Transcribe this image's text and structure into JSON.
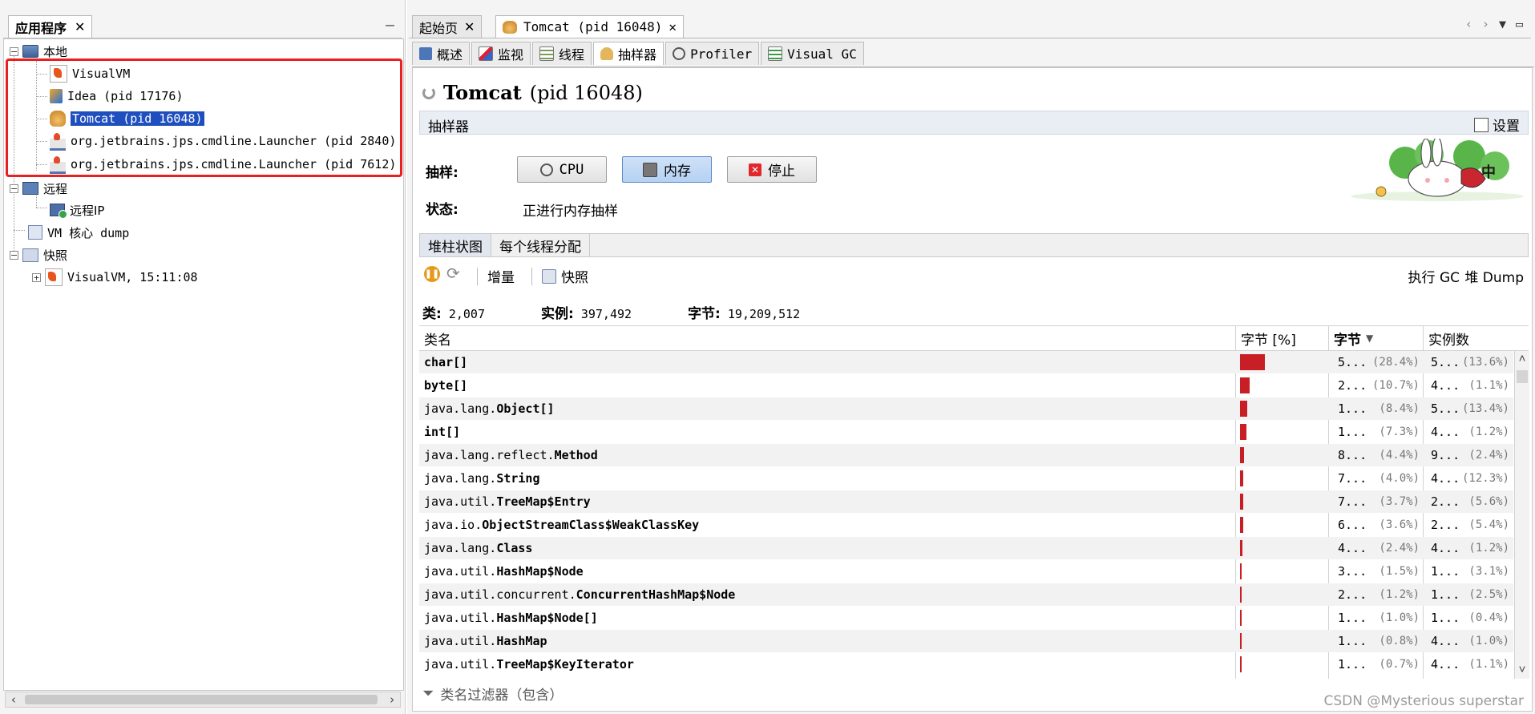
{
  "left_panel": {
    "tab_label": "应用程序",
    "minimize": "—",
    "tree": {
      "local": "本地",
      "visualvm": "VisualVM",
      "idea": "Idea (pid 17176)",
      "tomcat": "Tomcat (pid 16048)",
      "launcher1": "org.jetbrains.jps.cmdline.Launcher (pid 2840)",
      "launcher2": "org.jetbrains.jps.cmdline.Launcher (pid 7612)",
      "remote": "远程",
      "remote_ip": "远程IP",
      "vm_core_dump": "VM 核心 dump",
      "snapshots": "快照",
      "snapshot_item": "VisualVM, 15:11:08"
    }
  },
  "doc_tabs": [
    {
      "label": "起始页"
    },
    {
      "label": "Tomcat (pid 16048)"
    }
  ],
  "sub_tabs": [
    {
      "label": "概述"
    },
    {
      "label": "监视"
    },
    {
      "label": "线程"
    },
    {
      "label": "抽样器"
    },
    {
      "label": "Profiler"
    },
    {
      "label": "Visual GC"
    }
  ],
  "process_title": {
    "name": "Tomcat",
    "pid": "(pid 16048)"
  },
  "sampler": {
    "section_label": "抽样器",
    "settings_label": "设置",
    "sample_label": "抽样:",
    "buttons": {
      "cpu": "CPU",
      "memory": "内存",
      "stop": "停止"
    },
    "status_label": "状态:",
    "status_value": "正进行内存抽样",
    "mascot_text": "中"
  },
  "view_tabs": [
    {
      "label": "堆柱状图"
    },
    {
      "label": "每个线程分配"
    }
  ],
  "toolbar": {
    "delta": "增量",
    "snapshot": "快照",
    "gc": "执行 GC",
    "heap_dump": "堆 Dump"
  },
  "summary": {
    "classes_label": "类:",
    "classes": "2,007",
    "instances_label": "实例:",
    "instances": "397,492",
    "bytes_label": "字节:",
    "bytes": "19,209,512"
  },
  "table": {
    "headers": {
      "class_name": "类名",
      "bytes_pct": "字节 [%]",
      "bytes": "字节",
      "instances": "实例数"
    },
    "rows": [
      {
        "pkg": "",
        "cls": "char[]",
        "bytes": "5...",
        "bytes_pct": "(28.4%)",
        "bytes_frac": 0.284,
        "inst": "5...",
        "inst_pct": "(13.6%)"
      },
      {
        "pkg": "",
        "cls": "byte[]",
        "bytes": "2...",
        "bytes_pct": "(10.7%)",
        "bytes_frac": 0.107,
        "inst": "4...",
        "inst_pct": "(1.1%)"
      },
      {
        "pkg": "java.lang.",
        "cls": "Object[]",
        "bytes": "1...",
        "bytes_pct": "(8.4%)",
        "bytes_frac": 0.084,
        "inst": "5...",
        "inst_pct": "(13.4%)"
      },
      {
        "pkg": "",
        "cls": "int[]",
        "bytes": "1...",
        "bytes_pct": "(7.3%)",
        "bytes_frac": 0.073,
        "inst": "4...",
        "inst_pct": "(1.2%)"
      },
      {
        "pkg": "java.lang.reflect.",
        "cls": "Method",
        "bytes": "8...",
        "bytes_pct": "(4.4%)",
        "bytes_frac": 0.044,
        "inst": "9...",
        "inst_pct": "(2.4%)"
      },
      {
        "pkg": "java.lang.",
        "cls": "String",
        "bytes": "7...",
        "bytes_pct": "(4.0%)",
        "bytes_frac": 0.04,
        "inst": "4...",
        "inst_pct": "(12.3%)"
      },
      {
        "pkg": "java.util.",
        "cls": "TreeMap$Entry",
        "bytes": "7...",
        "bytes_pct": "(3.7%)",
        "bytes_frac": 0.037,
        "inst": "2...",
        "inst_pct": "(5.6%)"
      },
      {
        "pkg": "java.io.",
        "cls": "ObjectStreamClass$WeakClassKey",
        "bytes": "6...",
        "bytes_pct": "(3.6%)",
        "bytes_frac": 0.036,
        "inst": "2...",
        "inst_pct": "(5.4%)"
      },
      {
        "pkg": "java.lang.",
        "cls": "Class",
        "bytes": "4...",
        "bytes_pct": "(2.4%)",
        "bytes_frac": 0.024,
        "inst": "4...",
        "inst_pct": "(1.2%)"
      },
      {
        "pkg": "java.util.",
        "cls": "HashMap$Node",
        "bytes": "3...",
        "bytes_pct": "(1.5%)",
        "bytes_frac": 0.015,
        "inst": "1...",
        "inst_pct": "(3.1%)"
      },
      {
        "pkg": "java.util.concurrent.",
        "cls": "ConcurrentHashMap$Node",
        "bytes": "2...",
        "bytes_pct": "(1.2%)",
        "bytes_frac": 0.012,
        "inst": "1...",
        "inst_pct": "(2.5%)"
      },
      {
        "pkg": "java.util.",
        "cls": "HashMap$Node[]",
        "bytes": "1...",
        "bytes_pct": "(1.0%)",
        "bytes_frac": 0.01,
        "inst": "1...",
        "inst_pct": "(0.4%)"
      },
      {
        "pkg": "java.util.",
        "cls": "HashMap",
        "bytes": "1...",
        "bytes_pct": "(0.8%)",
        "bytes_frac": 0.008,
        "inst": "4...",
        "inst_pct": "(1.0%)"
      },
      {
        "pkg": "java.util.",
        "cls": "TreeMap$KeyIterator",
        "bytes": "1...",
        "bytes_pct": "(0.7%)",
        "bytes_frac": 0.007,
        "inst": "4...",
        "inst_pct": "(1.1%)"
      }
    ]
  },
  "filter_placeholder": "类名过滤器（包含）",
  "watermark": "CSDN @Mysterious superstar",
  "colors": {
    "bar": "#c81e25",
    "selection": "#1f4fbf",
    "highlight_box": "#ea1f1f"
  }
}
